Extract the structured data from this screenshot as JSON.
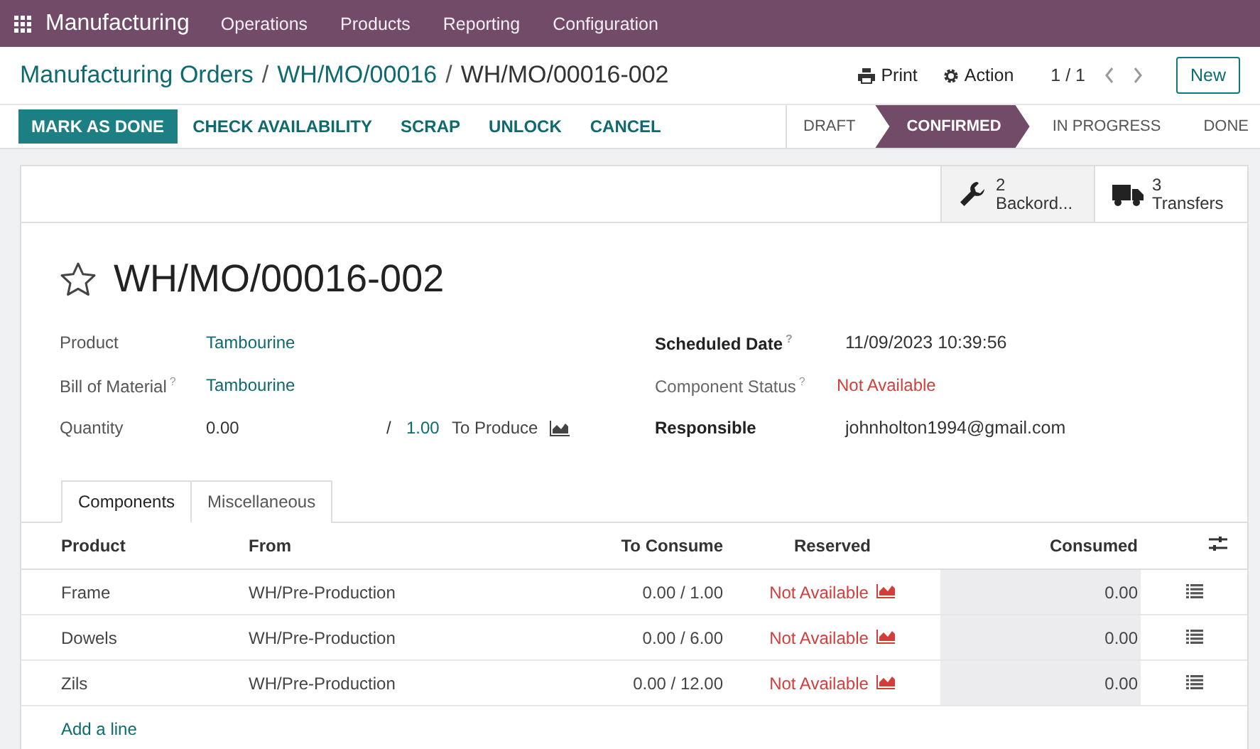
{
  "navbar": {
    "app": "Manufacturing",
    "menus": [
      "Operations",
      "Products",
      "Reporting",
      "Configuration"
    ]
  },
  "breadcrumbs": [
    {
      "label": "Manufacturing Orders",
      "link": true,
      "separator": "/"
    },
    {
      "label": "WH/MO/00016",
      "link": true,
      "separator": "/"
    },
    {
      "label": "WH/MO/00016-002",
      "link": false
    }
  ],
  "control_panel": {
    "print": "Print",
    "action": "Action",
    "pager": "1 / 1",
    "new": "New"
  },
  "buttons": [
    {
      "label": "MARK AS DONE",
      "kind": "primary"
    },
    {
      "label": "CHECK AVAILABILITY",
      "kind": "secondary"
    },
    {
      "label": "SCRAP",
      "kind": "secondary"
    },
    {
      "label": "UNLOCK",
      "kind": "secondary"
    },
    {
      "label": "CANCEL",
      "kind": "secondary"
    }
  ],
  "stages": [
    {
      "label": "DRAFT",
      "selected": false
    },
    {
      "label": "CONFIRMED",
      "selected": true
    },
    {
      "label": "IN PROGRESS",
      "selected": false
    },
    {
      "label": "DONE",
      "selected": false
    }
  ],
  "smart_buttons": [
    {
      "kind": "backorders",
      "count": "2",
      "label": "Backord..."
    },
    {
      "kind": "transfers",
      "count": "3",
      "label": "Transfers"
    }
  ],
  "record": {
    "title": "WH/MO/00016-002",
    "starred": false
  },
  "left_fields": [
    {
      "label": "Product",
      "value": "Tambourine",
      "kind": "link"
    },
    {
      "label": "Bill of Material",
      "help": "?",
      "value": "Tambourine",
      "kind": "link"
    }
  ],
  "quantity": {
    "label": "Quantity",
    "value": "0.00",
    "separator": "/",
    "target": "1.00",
    "unit_label": "To Produce"
  },
  "right_fields": [
    {
      "label": "Scheduled Date",
      "help": "?",
      "bold": true,
      "value": "11/09/2023 10:39:56",
      "kind": "plain"
    },
    {
      "label": "Component Status",
      "help": "?",
      "bold": false,
      "value": "Not Available",
      "kind": "danger"
    },
    {
      "label": "Responsible",
      "bold": true,
      "value": "johnholton1994@gmail.com",
      "kind": "plain"
    }
  ],
  "tabs": [
    {
      "label": "Components",
      "selected": true
    },
    {
      "label": "Miscellaneous",
      "selected": false
    }
  ],
  "table": {
    "columns": [
      "Product",
      "From",
      "To Consume",
      "Reserved",
      "Consumed"
    ],
    "rows": [
      {
        "product": "Frame",
        "from": "WH/Pre-Production",
        "to_consume": "0.00 /  1.00",
        "reserved": "Not Available",
        "consumed": "0.00"
      },
      {
        "product": "Dowels",
        "from": "WH/Pre-Production",
        "to_consume": "0.00 /  6.00",
        "reserved": "Not Available",
        "consumed": "0.00"
      },
      {
        "product": "Zils",
        "from": "WH/Pre-Production",
        "to_consume": "0.00 /  12.00",
        "reserved": "Not Available",
        "consumed": "0.00"
      }
    ],
    "add_line": "Add a line"
  }
}
